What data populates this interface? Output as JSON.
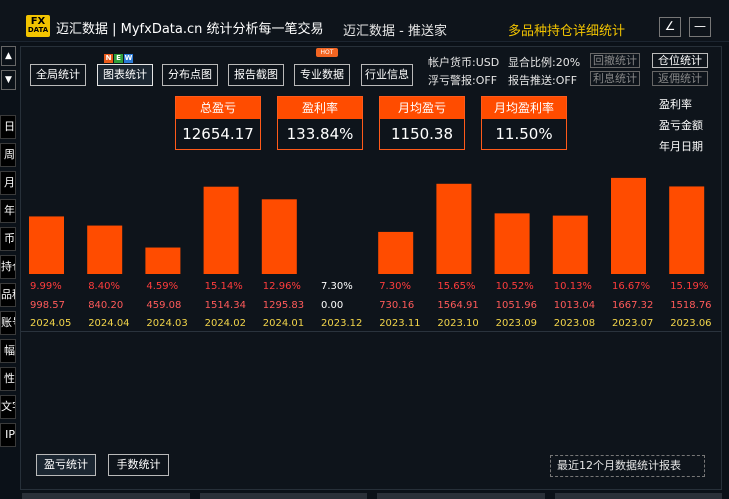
{
  "titlebar": {
    "logo_top": "FX",
    "logo_bottom": "DATA",
    "brand": "迈汇数据 | MyfxData.cn  统计分析每一笔交易",
    "center": "迈汇数据 - 推送家",
    "right": "多品种持仓详细统计",
    "edit_icon": "∠",
    "minimize_icon": "—"
  },
  "side_tabs": [
    "日",
    "周",
    "月",
    "年",
    "币",
    "持仓",
    "品种",
    "账号",
    "幅",
    "性",
    "文字",
    "IP"
  ],
  "toolbar": {
    "buttons": [
      "全局统计",
      "图表统计",
      "分布点图",
      "报告截图",
      "专业数据",
      "行业信息"
    ],
    "active": "图表统计",
    "new_badge": [
      "N",
      "E",
      "W"
    ],
    "hot_badge": "HOT",
    "currency": "帐户货币:USD",
    "ratio": "显合比例:20%",
    "float_alert": "浮亏警报:OFF",
    "report_push": "报告推送:OFF",
    "right_buttons": [
      "回撤统计",
      "仓位统计",
      "利息统计",
      "返佣统计"
    ],
    "right_active": "仓位统计"
  },
  "summary": [
    {
      "label": "总盈亏",
      "value": "12654.17"
    },
    {
      "label": "盈利率",
      "value": "133.84%"
    },
    {
      "label": "月均盈亏",
      "value": "1150.38"
    },
    {
      "label": "月均盈利率",
      "value": "11.50%"
    }
  ],
  "legend": [
    "盈利率",
    "盈亏金额",
    "年月日期"
  ],
  "colors": {
    "bar": "#ff4c00",
    "rate": "#ff3c3c",
    "amount": "#ff5a5a",
    "zero_text": "#ffffff",
    "date": "#f2d54a"
  },
  "chart_data": {
    "type": "bar",
    "categories": [
      "2024.05",
      "2024.04",
      "2024.03",
      "2024.02",
      "2024.01",
      "2023.12",
      "2023.11",
      "2023.10",
      "2023.09",
      "2023.08",
      "2023.07",
      "2023.06"
    ],
    "rates": [
      "9.99%",
      "8.40%",
      "4.59%",
      "15.14%",
      "12.96%",
      "7.30%",
      "7.30%",
      "15.65%",
      "10.52%",
      "10.13%",
      "16.67%",
      "15.19%"
    ],
    "amounts": [
      "998.57",
      "840.20",
      "459.08",
      "1514.34",
      "1295.83",
      "0.00",
      "730.16",
      "1564.91",
      "1051.96",
      "1013.04",
      "1667.32",
      "1518.76"
    ],
    "values": [
      998.57,
      840.2,
      459.08,
      1514.34,
      1295.83,
      0.0,
      730.16,
      1564.91,
      1051.96,
      1013.04,
      1667.32,
      1518.76
    ],
    "ylim": [
      0,
      1700
    ]
  },
  "bottom": {
    "buttons": [
      "盈亏统计",
      "手数统计"
    ],
    "active": "盈亏统计",
    "report": "最近12个月数据统计报表"
  }
}
